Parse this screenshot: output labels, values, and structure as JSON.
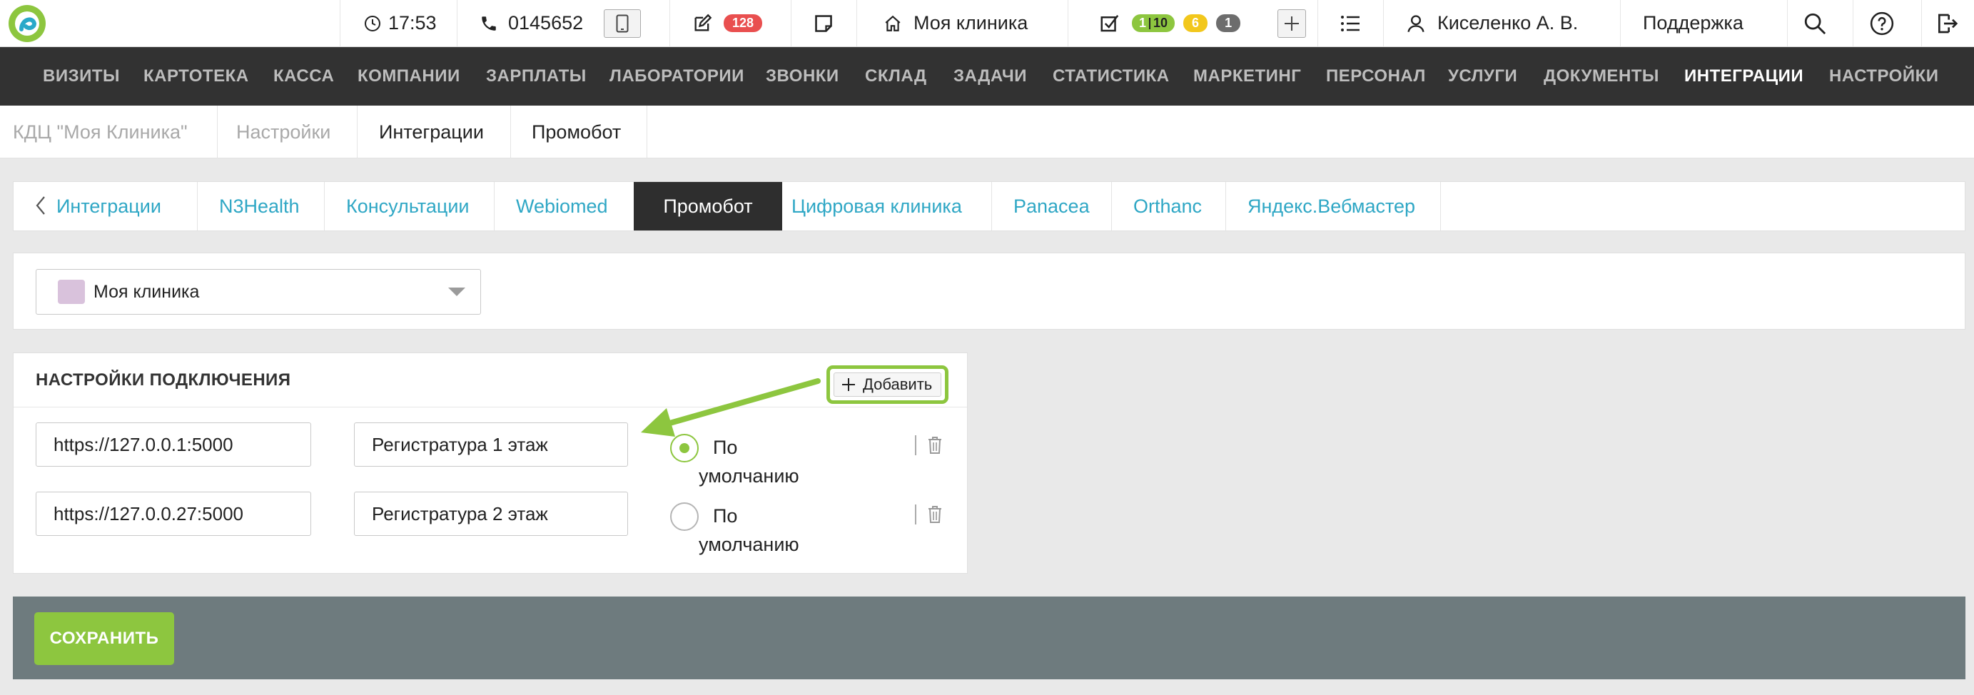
{
  "topbar": {
    "time": "17:53",
    "phone": "0145652",
    "notes_count": "128",
    "clinic": "Моя клиника",
    "tasks_badge_a": "1",
    "tasks_badge_b": "10",
    "tasks_badge_yellow": "6",
    "tasks_badge_gray": "1",
    "user_name": "Киселенко А. В.",
    "support": "Поддержка"
  },
  "nav": {
    "items": [
      "ВИЗИТЫ",
      "КАРТОТЕКА",
      "КАССА",
      "КОМПАНИИ",
      "ЗАРПЛАТЫ",
      "ЛАБОРАТОРИИ",
      "ЗВОНКИ",
      "СКЛАД",
      "ЗАДАЧИ",
      "СТАТИСТИКА",
      "МАРКЕТИНГ",
      "ПЕРСОНАЛ",
      "УСЛУГИ",
      "ДОКУМЕНТЫ",
      "ИНТЕГРАЦИИ",
      "НАСТРОЙКИ"
    ],
    "active": "ИНТЕГРАЦИИ"
  },
  "breadcrumb": [
    "КДЦ \"Моя Клиника\"",
    "Настройки",
    "Интеграции",
    "Промобот"
  ],
  "tabs": {
    "back_label": "Интеграции",
    "items": [
      "N3Health",
      "Консультации",
      "Webiomed",
      "Промобот",
      "Цифровая клиника",
      "Panacea",
      "Orthanc",
      "Яндекс.Вебмастер"
    ],
    "active": "Промобот"
  },
  "clinic_select": {
    "value": "Моя клиника",
    "swatch_color": "#d9c2dc"
  },
  "connection": {
    "title": "НАСТРОЙКИ ПОДКЛЮЧЕНИЯ",
    "add_label": "Добавить",
    "rows": [
      {
        "url": "https://127.0.0.1:5000",
        "name": "Регистратура 1 этаж",
        "default_label_1": "По",
        "default_label_2": "умолчанию",
        "is_default": true
      },
      {
        "url": "https://127.0.0.27:5000",
        "name": "Регистратура 2 этаж",
        "default_label_1": "По",
        "default_label_2": "умолчанию",
        "is_default": false
      }
    ]
  },
  "footer": {
    "save_label": "СОХРАНИТЬ"
  },
  "colors": {
    "accent_green": "#8dc63f",
    "link_blue": "#2fa7c5",
    "nav_bg": "#323232",
    "badge_red": "#e94f4f",
    "badge_yellow": "#f2c71c",
    "badge_gray": "#6d6d6d",
    "footer_bg": "#6e7b7e"
  }
}
